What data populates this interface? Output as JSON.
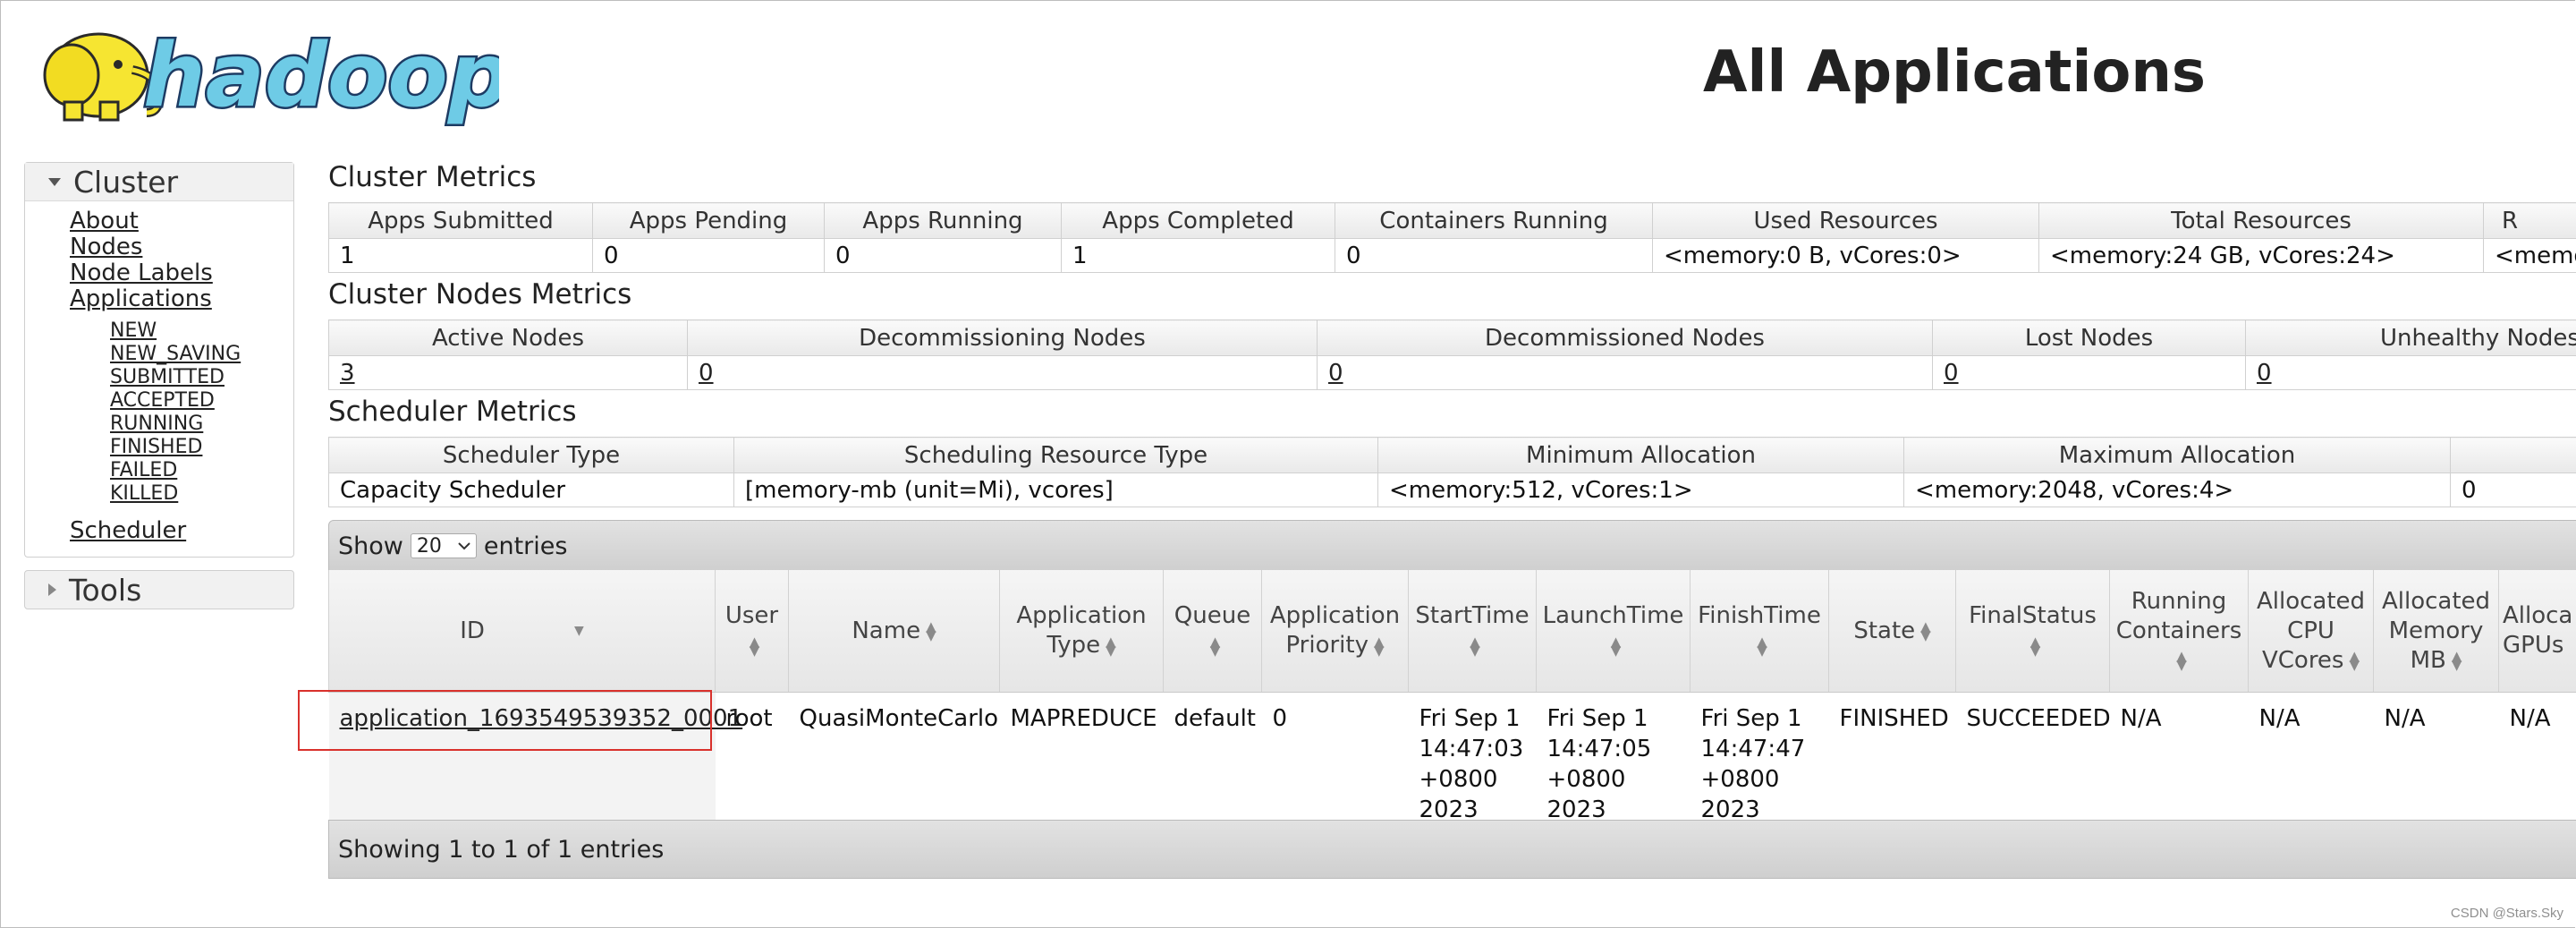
{
  "header": {
    "logo_text": "hadoop",
    "title": "All Applications"
  },
  "sidebar": {
    "cluster_label": "Cluster",
    "links": [
      "About",
      "Nodes",
      "Node Labels",
      "Applications"
    ],
    "app_states": [
      "NEW",
      "NEW_SAVING",
      "SUBMITTED",
      "ACCEPTED",
      "RUNNING",
      "FINISHED",
      "FAILED",
      "KILLED"
    ],
    "scheduler_label": "Scheduler",
    "tools_label": "Tools"
  },
  "cluster_metrics": {
    "title": "Cluster Metrics",
    "headers": [
      "Apps Submitted",
      "Apps Pending",
      "Apps Running",
      "Apps Completed",
      "Containers Running",
      "Used Resources",
      "Total Resources",
      "R"
    ],
    "values": [
      "1",
      "0",
      "0",
      "1",
      "0",
      "<memory:0 B, vCores:0>",
      "<memory:24 GB, vCores:24>",
      "<memo"
    ]
  },
  "node_metrics": {
    "title": "Cluster Nodes Metrics",
    "headers": [
      "Active Nodes",
      "Decommissioning Nodes",
      "Decommissioned Nodes",
      "Lost Nodes",
      "Unhealthy Nodes"
    ],
    "values": [
      "3",
      "0",
      "0",
      "0",
      "0"
    ]
  },
  "scheduler_metrics": {
    "title": "Scheduler Metrics",
    "headers": [
      "Scheduler Type",
      "Scheduling Resource Type",
      "Minimum Allocation",
      "Maximum Allocation",
      ""
    ],
    "values": [
      "Capacity Scheduler",
      "[memory-mb (unit=Mi), vcores]",
      "<memory:512, vCores:1>",
      "<memory:2048, vCores:4>",
      "0"
    ]
  },
  "apps_table": {
    "show_label": "Show",
    "page_size": "20",
    "entries_label": "entries",
    "columns": [
      "ID",
      "User",
      "Name",
      "Application Type",
      "Queue",
      "Application Priority",
      "StartTime",
      "LaunchTime",
      "FinishTime",
      "State",
      "FinalStatus",
      "Running Containers",
      "Allocated CPU VCores",
      "Allocated Memory MB",
      "Alloca GPUs"
    ],
    "row": {
      "id": "application_1693549539352_0001",
      "user": "root",
      "name": "QuasiMonteCarlo",
      "type": "MAPREDUCE",
      "queue": "default",
      "priority": "0",
      "start_time": "Fri Sep 1 14:47:03 +0800 2023",
      "launch_time": "Fri Sep 1 14:47:05 +0800 2023",
      "finish_time": "Fri Sep 1 14:47:47 +0800 2023",
      "state": "FINISHED",
      "final_status": "SUCCEEDED",
      "running_containers": "N/A",
      "alloc_vcores": "N/A",
      "alloc_memory": "N/A",
      "alloc_gpus": "N/A"
    },
    "footer": "Showing 1 to 1 of 1 entries"
  },
  "watermark": "CSDN @Stars.Sky",
  "colors": {
    "highlight": "#d9312c",
    "logo_elephant": "#f6e531",
    "logo_text": "#1d3b63"
  }
}
